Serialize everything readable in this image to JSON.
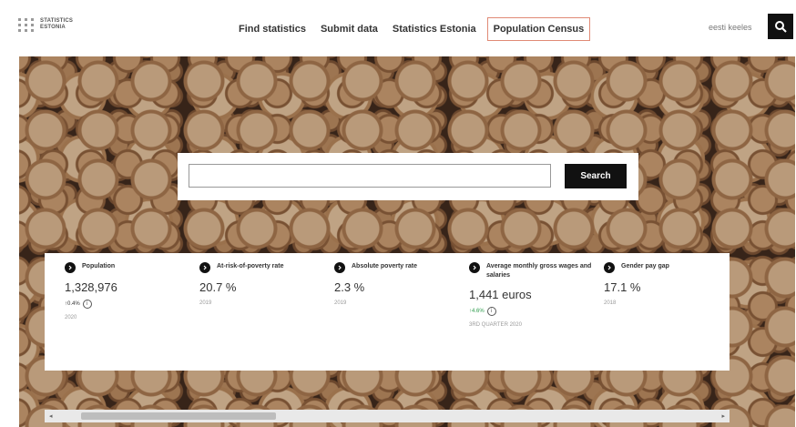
{
  "header": {
    "logo_line1": "STATISTICS",
    "logo_line2": "ESTONIA",
    "nav": [
      "Find statistics",
      "Submit data",
      "Statistics Estonia",
      "Population Census"
    ],
    "language": "eesti keeles",
    "search_icon": "search-icon"
  },
  "hero": {
    "search_placeholder": "",
    "search_button": "Search"
  },
  "stats": [
    {
      "title": "Population",
      "value": "1,328,976",
      "change": "0.4%",
      "change_dir": "up",
      "period": "2020"
    },
    {
      "title": "At-risk-of-poverty rate",
      "value": "20.7 %",
      "change": "",
      "change_dir": "",
      "period": "2019"
    },
    {
      "title": "Absolute poverty rate",
      "value": "2.3 %",
      "change": "",
      "change_dir": "",
      "period": "2019"
    },
    {
      "title": "Average monthly gross wages and salaries",
      "value": "1,441 euros",
      "change": "4.6%",
      "change_dir": "up",
      "period": "3RD QUARTER 2020"
    },
    {
      "title": "Gender pay gap",
      "value": "17.1 %",
      "change": "",
      "change_dir": "",
      "period": "2018"
    }
  ],
  "colors": {
    "active_nav_border": "#e08a75",
    "button_bg": "#111111",
    "positive": "#2e9c4c"
  }
}
